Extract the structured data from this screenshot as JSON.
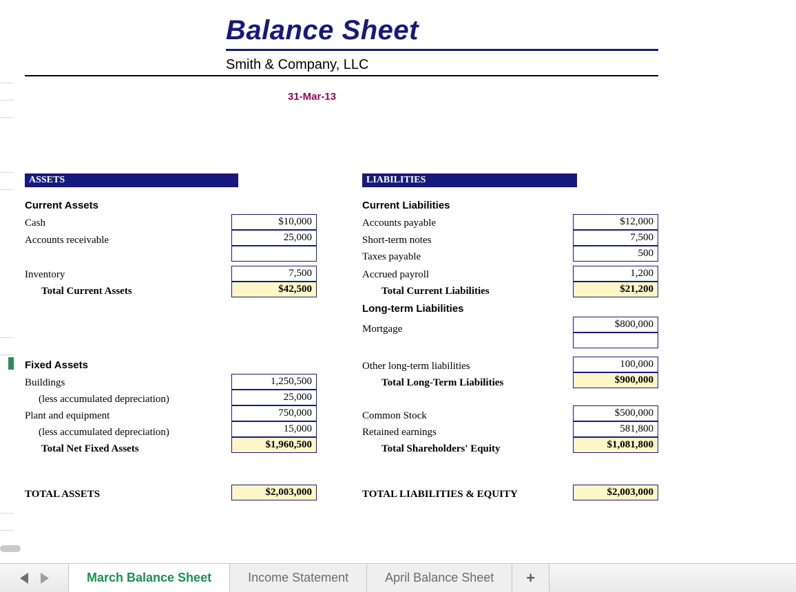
{
  "title": "Balance Sheet",
  "company": "Smith & Company, LLC",
  "date": "31-Mar-13",
  "sections": {
    "assets_header": "ASSETS",
    "liab_header": "LIABILITIES"
  },
  "assets": {
    "current_heading": "Current Assets",
    "cash_label": "Cash",
    "cash_value": "$10,000",
    "ar_label": "Accounts receivable",
    "ar_value": "25,000",
    "inventory_label": "Inventory",
    "inventory_value": "7,500",
    "total_current_label": "Total Current Assets",
    "total_current_value": "$42,500",
    "fixed_heading": "Fixed Assets",
    "buildings_label": "Buildings",
    "buildings_value": "1,250,500",
    "dep1_label": "(less accumulated depreciation)",
    "dep1_value": "25,000",
    "plant_label": "Plant and equipment",
    "plant_value": "750,000",
    "dep2_label": "(less accumulated depreciation)",
    "dep2_value": "15,000",
    "total_fixed_label": "Total Net Fixed Assets",
    "total_fixed_value": "$1,960,500",
    "total_assets_label": "TOTAL ASSETS",
    "total_assets_value": "$2,003,000"
  },
  "liabilities": {
    "current_heading": "Current Liabilities",
    "ap_label": "Accounts payable",
    "ap_value": "$12,000",
    "stn_label": "Short-term notes",
    "stn_value": "7,500",
    "taxes_label": "Taxes payable",
    "taxes_value": "500",
    "payroll_label": "Accrued payroll",
    "payroll_value": "1,200",
    "total_current_label": "Total Current Liabilities",
    "total_current_value": "$21,200",
    "longterm_heading": "Long-term Liabilities",
    "mortgage_label": "Mortgage",
    "mortgage_value": "$800,000",
    "other_lt_label": "Other long-term liabilities",
    "other_lt_value": "100,000",
    "total_lt_label": "Total Long-Term Liabilities",
    "total_lt_value": "$900,000",
    "common_stock_label": "Common Stock",
    "common_stock_value": "$500,000",
    "retained_label": "Retained earnings",
    "retained_value": "581,800",
    "total_equity_label": "Total Shareholders' Equity",
    "total_equity_value": "$1,081,800",
    "total_le_label": "TOTAL LIABILITIES & EQUITY",
    "total_le_value": "$2,003,000"
  },
  "tabs": {
    "t1": "March Balance Sheet",
    "t2": "Income Statement",
    "t3": "April Balance Sheet",
    "add": "+"
  }
}
